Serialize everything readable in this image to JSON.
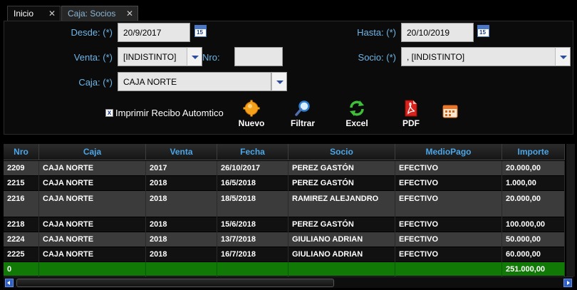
{
  "tabs": [
    {
      "label": "Inicio",
      "close": "✕"
    },
    {
      "label": "Caja: Socios",
      "close": "✕"
    }
  ],
  "filters": {
    "desde_label": "Desde: (*)",
    "desde_value": "20/9/2017",
    "hasta_label": "Hasta: (*)",
    "hasta_value": "20/10/2019",
    "calendar_icon_text": "15",
    "venta_label": "Venta: (*)",
    "venta_value": "[INDISTINTO]",
    "nro_label": "Nro:",
    "nro_value": "",
    "socio_label": "Socio: (*)",
    "socio_value": ", [INDISTINTO]",
    "caja_label": "Caja: (*)",
    "caja_value": "CAJA NORTE"
  },
  "options": {
    "checkbox_mark": "x",
    "checkbox_label": "Imprimir Recibo Automtico",
    "checked": true
  },
  "toolbar": {
    "nuevo": "Nuevo",
    "filtrar": "Filtrar",
    "excel": "Excel",
    "pdf": "PDF"
  },
  "table": {
    "columns": [
      "Nro",
      "Caja",
      "Venta",
      "Fecha",
      "Socio",
      "MedioPago",
      "Importe"
    ],
    "rows": [
      [
        "2209",
        "CAJA NORTE",
        "2017",
        "26/10/2017",
        "PEREZ GASTÓN",
        "EFECTIVO",
        "20.000,00"
      ],
      [
        "2215",
        "CAJA NORTE",
        "2018",
        "16/5/2018",
        "PEREZ GASTÓN",
        "EFECTIVO",
        "1.000,00"
      ],
      [
        "2216",
        "CAJA NORTE",
        "2018",
        "18/5/2018",
        "RAMIREZ ALEJANDRO",
        "EFECTIVO",
        "20.000,00"
      ],
      [
        "2218",
        "CAJA NORTE",
        "2018",
        "15/6/2018",
        "PEREZ GASTÓN",
        "EFECTIVO",
        "100.000,00"
      ],
      [
        "2224",
        "CAJA NORTE",
        "2018",
        "13/7/2018",
        "GIULIANO ADRIAN",
        "EFECTIVO",
        "50.000,00"
      ],
      [
        "2225",
        "CAJA NORTE",
        "2018",
        "16/7/2018",
        "GIULIANO ADRIAN",
        "EFECTIVO",
        "60.000,00"
      ]
    ],
    "total": [
      "0",
      "",
      "",
      "",
      "",
      "",
      "251.000,00"
    ]
  },
  "colors": {
    "label_blue": "#6fb6e8",
    "header_blue": "#4aa6e8",
    "total_green": "#117a06"
  }
}
